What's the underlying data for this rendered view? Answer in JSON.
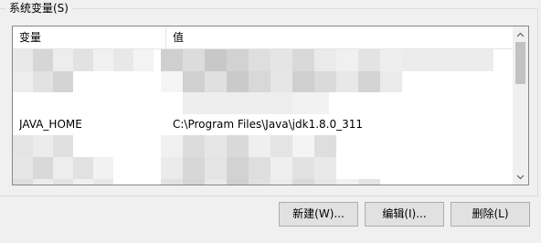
{
  "group": {
    "title": "系统变量(S)"
  },
  "list": {
    "columns": [
      {
        "label": "变量"
      },
      {
        "label": "值"
      }
    ],
    "rows": [
      {
        "name": "",
        "value": ""
      },
      {
        "name": "",
        "value": ""
      },
      {
        "name": "",
        "value": ""
      },
      {
        "name": "JAVA_HOME",
        "value": "C:\\Program Files\\Java\\jdk1.8.0_311"
      },
      {
        "name": "",
        "value": ""
      },
      {
        "name": "",
        "value": ""
      },
      {
        "name": "",
        "value": ""
      }
    ]
  },
  "scrollbar": {
    "up_icon": "chevron-up-icon",
    "down_icon": "chevron-down-icon",
    "thumb_position": 0.0
  },
  "buttons": {
    "new_label": "新建(W)...",
    "edit_label": "编辑(I)...",
    "delete_label": "删除(L)"
  },
  "colors": {
    "window_bg": "#f0f0f0",
    "list_bg": "#ffffff",
    "list_border": "#828790",
    "button_bg": "#e1e1e1",
    "button_border": "#adadad",
    "thumb": "#c2c2c2"
  }
}
